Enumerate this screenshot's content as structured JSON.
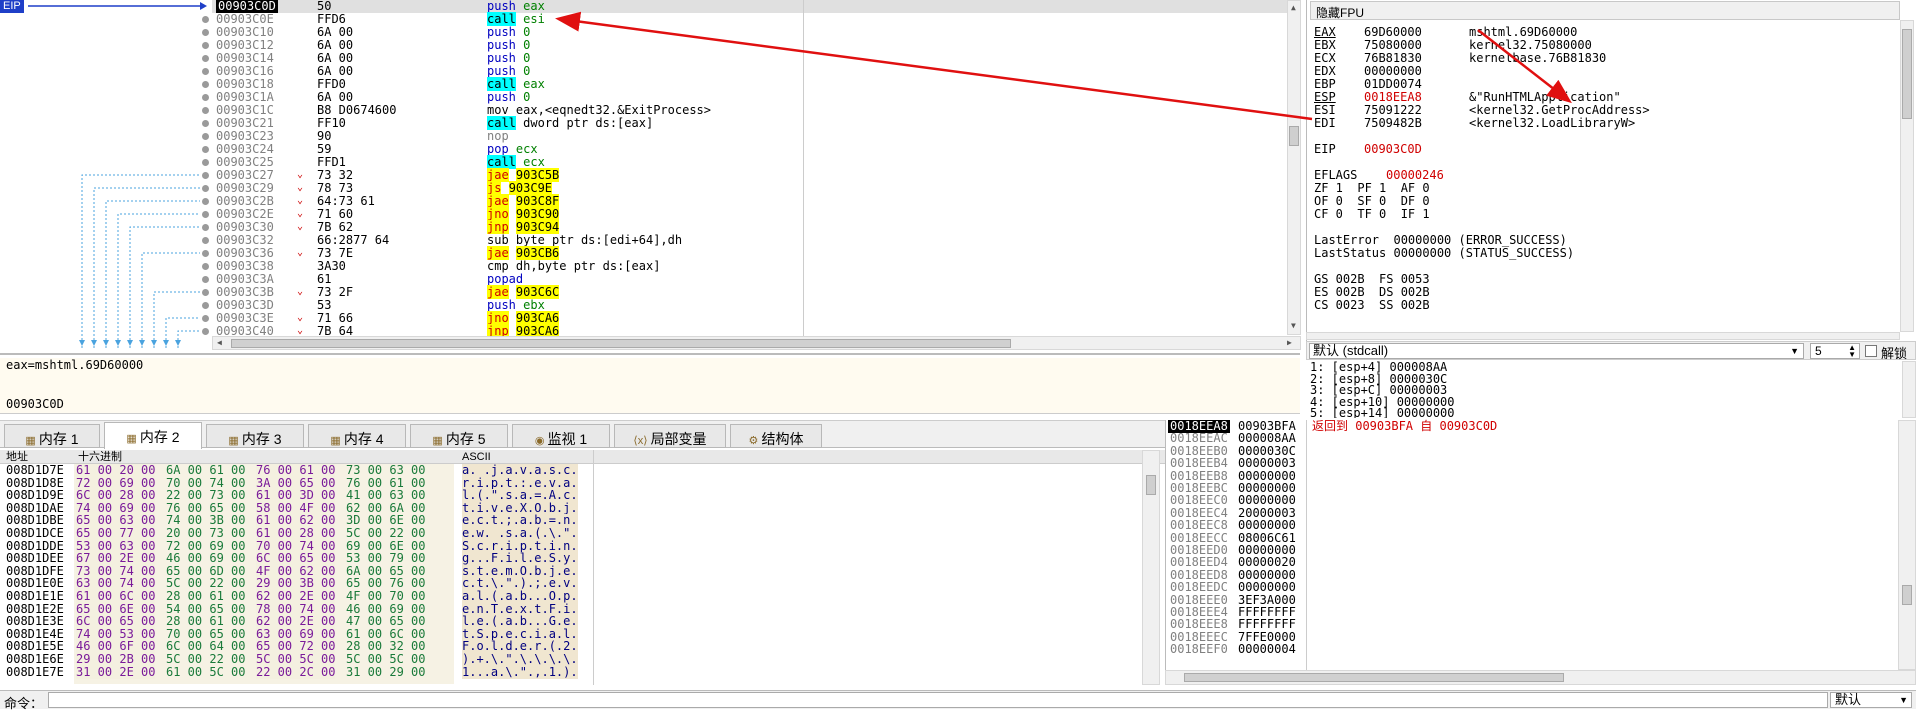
{
  "disasm": {
    "eip_tag": "EIP",
    "rows": [
      {
        "addr": "00903C0D",
        "bytes": "50",
        "mn": "push",
        "ops": "eax",
        "cur": true,
        "mnc": "push"
      },
      {
        "addr": "00903C0E",
        "bytes": "FFD6",
        "mn": "call",
        "ops": "esi",
        "mnc": "call"
      },
      {
        "addr": "00903C10",
        "bytes": "6A 00",
        "mn": "push",
        "ops": "0",
        "mnc": "push"
      },
      {
        "addr": "00903C12",
        "bytes": "6A 00",
        "mn": "push",
        "ops": "0",
        "mnc": "push"
      },
      {
        "addr": "00903C14",
        "bytes": "6A 00",
        "mn": "push",
        "ops": "0",
        "mnc": "push"
      },
      {
        "addr": "00903C16",
        "bytes": "6A 00",
        "mn": "push",
        "ops": "0",
        "mnc": "push"
      },
      {
        "addr": "00903C18",
        "bytes": "FFD0",
        "mn": "call",
        "ops": "eax",
        "mnc": "call"
      },
      {
        "addr": "00903C1A",
        "bytes": "6A 00",
        "mn": "push",
        "ops": "0",
        "mnc": "push"
      },
      {
        "addr": "00903C1C",
        "bytes": "B8 D0674600",
        "mn": "mov",
        "ops": "eax,<eqnedt32.&ExitProcess>",
        "mnc": "mov"
      },
      {
        "addr": "00903C21",
        "bytes": "FF10",
        "mn": "call",
        "ops": "dword ptr ds:[eax]",
        "mnc": "call"
      },
      {
        "addr": "00903C23",
        "bytes": "90",
        "mn": "nop",
        "ops": "",
        "mnc": "nop"
      },
      {
        "addr": "00903C24",
        "bytes": "59",
        "mn": "pop",
        "ops": "ecx",
        "mnc": "push"
      },
      {
        "addr": "00903C25",
        "bytes": "FFD1",
        "mn": "call",
        "ops": "ecx",
        "mnc": "call"
      },
      {
        "addr": "00903C27",
        "bytes": "73 32",
        "mn": "jae",
        "ops": "903C5B",
        "mnc": "j"
      },
      {
        "addr": "00903C29",
        "bytes": "78 73",
        "mn": "js",
        "ops": "903C9E",
        "mnc": "j"
      },
      {
        "addr": "00903C2B",
        "bytes": "64:73 61",
        "mn": "jae",
        "ops": "903C8F",
        "mnc": "j"
      },
      {
        "addr": "00903C2E",
        "bytes": "71 60",
        "mn": "jno",
        "ops": "903C90",
        "mnc": "j"
      },
      {
        "addr": "00903C30",
        "bytes": "7B 62",
        "mn": "jnp",
        "ops": "903C94",
        "mnc": "j"
      },
      {
        "addr": "00903C32",
        "bytes": "66:2877 64",
        "mn": "sub",
        "ops": "byte ptr ds:[edi+64],dh",
        "mnc": "mov"
      },
      {
        "addr": "00903C36",
        "bytes": "73 7E",
        "mn": "jae",
        "ops": "903CB6",
        "mnc": "j"
      },
      {
        "addr": "00903C38",
        "bytes": "3A30",
        "mn": "cmp",
        "ops": "dh,byte ptr ds:[eax]",
        "mnc": "mov"
      },
      {
        "addr": "00903C3A",
        "bytes": "61",
        "mn": "popad",
        "ops": "",
        "mnc": "push"
      },
      {
        "addr": "00903C3B",
        "bytes": "73 2F",
        "mn": "jae",
        "ops": "903C6C",
        "mnc": "j"
      },
      {
        "addr": "00903C3D",
        "bytes": "53",
        "mn": "push",
        "ops": "ebx",
        "mnc": "push"
      },
      {
        "addr": "00903C3E",
        "bytes": "71 66",
        "mn": "jno",
        "ops": "903CA6",
        "mnc": "j"
      },
      {
        "addr": "00903C40",
        "bytes": "7B 64",
        "mn": "jnp",
        "ops": "903CA6",
        "mnc": "j"
      }
    ]
  },
  "registers": {
    "title": "隐藏FPU",
    "gp": [
      {
        "name": "EAX",
        "val": "69D60000",
        "note": "mshtml.69D60000",
        "red": false
      },
      {
        "name": "EBX",
        "val": "75080000",
        "note": "kernel32.75080000",
        "red": false
      },
      {
        "name": "ECX",
        "val": "76B81830",
        "note": "kernelbase.76B81830",
        "red": false
      },
      {
        "name": "EDX",
        "val": "00000000",
        "note": "",
        "red": false
      },
      {
        "name": "EBP",
        "val": "01DD0074",
        "note": "",
        "red": false
      },
      {
        "name": "ESP",
        "val": "0018EEA8",
        "note": "&\"RunHTMLApplication\"",
        "red": true
      },
      {
        "name": "ESI",
        "val": "75091222",
        "note": "<kernel32.GetProcAddress>",
        "red": false
      },
      {
        "name": "EDI",
        "val": "7509482B",
        "note": "<kernel32.LoadLibraryW>",
        "red": false
      }
    ],
    "eip_label": "EIP",
    "eip_val": "00903C0D",
    "eflags_label": "EFLAGS",
    "eflags_val": "00000246",
    "flags": [
      "ZF 1  PF 1  AF 0",
      "OF 0  SF 0  DF 0",
      "CF 0  TF 0  IF 1"
    ],
    "lasterror": "LastError  00000000 (ERROR_SUCCESS)",
    "laststatus": "LastStatus 00000000 (STATUS_SUCCESS)",
    "segs": [
      "GS 002B  FS 0053",
      "ES 002B  DS 002B",
      "CS 0023  SS 002B"
    ]
  },
  "callconv": {
    "label": "默认 (stdcall)",
    "count": "5",
    "unlock": "解锁"
  },
  "args": [
    "1: [esp+4] 000008AA",
    "2: [esp+8] 0000030C",
    "3: [esp+C] 00000003",
    "4: [esp+10] 00000000",
    "5: [esp+14] 00000000"
  ],
  "info": {
    "line1": "eax=mshtml.69D60000",
    "line2": "00903C0D"
  },
  "tabs": [
    {
      "label": "内存 1",
      "icon": "memory-icon"
    },
    {
      "label": "内存 2",
      "icon": "memory-icon",
      "active": true
    },
    {
      "label": "内存 3",
      "icon": "memory-icon"
    },
    {
      "label": "内存 4",
      "icon": "memory-icon"
    },
    {
      "label": "内存 5",
      "icon": "memory-icon"
    },
    {
      "label": "监视 1",
      "icon": "watch-icon"
    },
    {
      "label": "局部变量",
      "icon": "locals-icon"
    },
    {
      "label": "结构体",
      "icon": "struct-icon"
    }
  ],
  "dump": {
    "headers": {
      "addr": "地址",
      "hex": "十六进制",
      "ascii": "ASCII"
    },
    "rows": [
      {
        "a": "008D1D7E",
        "h": [
          "61 00 20 00",
          "6A 00 61 00",
          "76 00 61 00",
          "73 00 63 00"
        ],
        "s": "a. .j.a.v.a.s.c."
      },
      {
        "a": "008D1D8E",
        "h": [
          "72 00 69 00",
          "70 00 74 00",
          "3A 00 65 00",
          "76 00 61 00"
        ],
        "s": "r.i.p.t.:.e.v.a."
      },
      {
        "a": "008D1D9E",
        "h": [
          "6C 00 28 00",
          "22 00 73 00",
          "61 00 3D 00",
          "41 00 63 00"
        ],
        "s": "l.(.\".s.a.=.A.c."
      },
      {
        "a": "008D1DAE",
        "h": [
          "74 00 69 00",
          "76 00 65 00",
          "58 00 4F 00",
          "62 00 6A 00"
        ],
        "s": "t.i.v.e.X.O.b.j."
      },
      {
        "a": "008D1DBE",
        "h": [
          "65 00 63 00",
          "74 00 3B 00",
          "61 00 62 00",
          "3D 00 6E 00"
        ],
        "s": "e.c.t.;.a.b.=.n."
      },
      {
        "a": "008D1DCE",
        "h": [
          "65 00 77 00",
          "20 00 73 00",
          "61 00 28 00",
          "5C 00 22 00"
        ],
        "s": "e.w. .s.a.(.\\.\"."
      },
      {
        "a": "008D1DDE",
        "h": [
          "53 00 63 00",
          "72 00 69 00",
          "70 00 74 00",
          "69 00 6E 00"
        ],
        "s": "S.c.r.i.p.t.i.n."
      },
      {
        "a": "008D1DEE",
        "h": [
          "67 00 2E 00",
          "46 00 69 00",
          "6C 00 65 00",
          "53 00 79 00"
        ],
        "s": "g...F.i.l.e.S.y."
      },
      {
        "a": "008D1DFE",
        "h": [
          "73 00 74 00",
          "65 00 6D 00",
          "4F 00 62 00",
          "6A 00 65 00"
        ],
        "s": "s.t.e.m.O.b.j.e."
      },
      {
        "a": "008D1E0E",
        "h": [
          "63 00 74 00",
          "5C 00 22 00",
          "29 00 3B 00",
          "65 00 76 00"
        ],
        "s": "c.t.\\.\".).;.e.v."
      },
      {
        "a": "008D1E1E",
        "h": [
          "61 00 6C 00",
          "28 00 61 00",
          "62 00 2E 00",
          "4F 00 70 00"
        ],
        "s": "a.l.(.a.b...O.p."
      },
      {
        "a": "008D1E2E",
        "h": [
          "65 00 6E 00",
          "54 00 65 00",
          "78 00 74 00",
          "46 00 69 00"
        ],
        "s": "e.n.T.e.x.t.F.i."
      },
      {
        "a": "008D1E3E",
        "h": [
          "6C 00 65 00",
          "28 00 61 00",
          "62 00 2E 00",
          "47 00 65 00"
        ],
        "s": "l.e.(.a.b...G.e."
      },
      {
        "a": "008D1E4E",
        "h": [
          "74 00 53 00",
          "70 00 65 00",
          "63 00 69 00",
          "61 00 6C 00"
        ],
        "s": "t.S.p.e.c.i.a.l."
      },
      {
        "a": "008D1E5E",
        "h": [
          "46 00 6F 00",
          "6C 00 64 00",
          "65 00 72 00",
          "28 00 32 00"
        ],
        "s": "F.o.l.d.e.r.(.2."
      },
      {
        "a": "008D1E6E",
        "h": [
          "29 00 2B 00",
          "5C 00 22 00",
          "5C 00 5C 00",
          "5C 00 5C 00"
        ],
        "s": ").+.\\.\".\\.\\.\\.\\."
      },
      {
        "a": "008D1E7E",
        "h": [
          "31 00 2E 00",
          "61 00 5C 00",
          "22 00 2C 00",
          "31 00 29 00"
        ],
        "s": "1...a.\\.\".,.1.)."
      }
    ]
  },
  "stack": {
    "rows": [
      {
        "a": "0018EEA8",
        "v": "00903BFA",
        "c": "返回到 00903BFA 自 00903C0D",
        "cur": true
      },
      {
        "a": "0018EEAC",
        "v": "000008AA",
        "c": ""
      },
      {
        "a": "0018EEB0",
        "v": "0000030C",
        "c": ""
      },
      {
        "a": "0018EEB4",
        "v": "00000003",
        "c": ""
      },
      {
        "a": "0018EEB8",
        "v": "00000000",
        "c": ""
      },
      {
        "a": "0018EEBC",
        "v": "00000000",
        "c": ""
      },
      {
        "a": "0018EEC0",
        "v": "00000000",
        "c": ""
      },
      {
        "a": "0018EEC4",
        "v": "20000003",
        "c": ""
      },
      {
        "a": "0018EEC8",
        "v": "00000000",
        "c": ""
      },
      {
        "a": "0018EECC",
        "v": "08006C61",
        "c": ""
      },
      {
        "a": "0018EED0",
        "v": "00000000",
        "c": ""
      },
      {
        "a": "0018EED4",
        "v": "00000020",
        "c": ""
      },
      {
        "a": "0018EED8",
        "v": "00000000",
        "c": ""
      },
      {
        "a": "0018EEDC",
        "v": "00000000",
        "c": ""
      },
      {
        "a": "0018EEE0",
        "v": "3EF3A000",
        "c": ""
      },
      {
        "a": "0018EEE4",
        "v": "FFFFFFFF",
        "c": ""
      },
      {
        "a": "0018EEE8",
        "v": "FFFFFFFF",
        "c": ""
      },
      {
        "a": "0018EEEC",
        "v": "7FFE0000",
        "c": ""
      },
      {
        "a": "0018EEF0",
        "v": "00000004",
        "c": ""
      }
    ]
  },
  "command": {
    "label": "命令：",
    "mode": "默认"
  },
  "colors": {
    "arrow": "#e01010",
    "call_bg": "#00ffff",
    "jump_bg": "#ffff00",
    "eip_bg": "#1f3fc8"
  }
}
